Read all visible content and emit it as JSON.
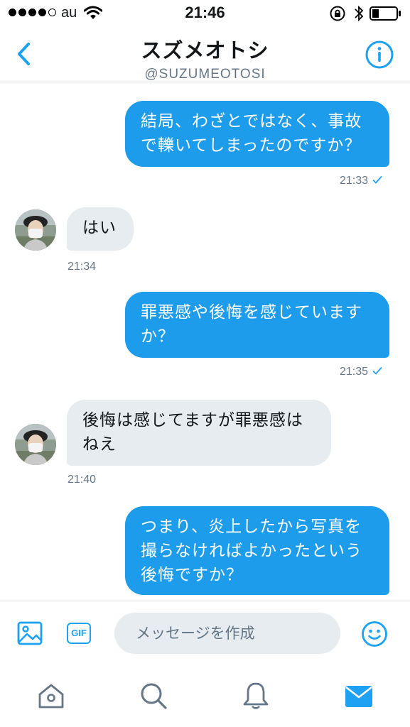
{
  "status_bar": {
    "carrier": "au",
    "time": "21:46"
  },
  "header": {
    "title": "スズメオトシ",
    "handle": "@SUZUMEOTOSI",
    "back_icon": "chevron-left-icon",
    "info_icon": "info-icon"
  },
  "messages": [
    {
      "direction": "out",
      "text": "結局、わざとではなく、事故\nで轢いてしまったのですか？",
      "time": "21:33",
      "read": true
    },
    {
      "direction": "in",
      "text": "はい",
      "time": "21:34"
    },
    {
      "direction": "out",
      "text": "罪悪感や後悔を感じています\nか？",
      "time": "21:35",
      "read": true
    },
    {
      "direction": "in",
      "text": "後悔は感じてますが罪悪感は\nねえ",
      "time": "21:40"
    },
    {
      "direction": "out",
      "text": "つまり、炎上したから写真を\n撮らなければよかったという\n後悔ですか？"
    }
  ],
  "compose": {
    "placeholder": "メッセージを作成",
    "gif_label": "GIF"
  },
  "tabs": [
    {
      "name": "home-icon",
      "active": false
    },
    {
      "name": "search-icon",
      "active": false
    },
    {
      "name": "notifications-icon",
      "active": false
    },
    {
      "name": "messages-icon",
      "active": true
    }
  ],
  "colors": {
    "accent": "#1da1f2",
    "outgoing_bubble": "#1d9ceb",
    "incoming_bubble": "#e6ecf0",
    "muted_text": "#657786",
    "inactive_icon": "#657786"
  }
}
